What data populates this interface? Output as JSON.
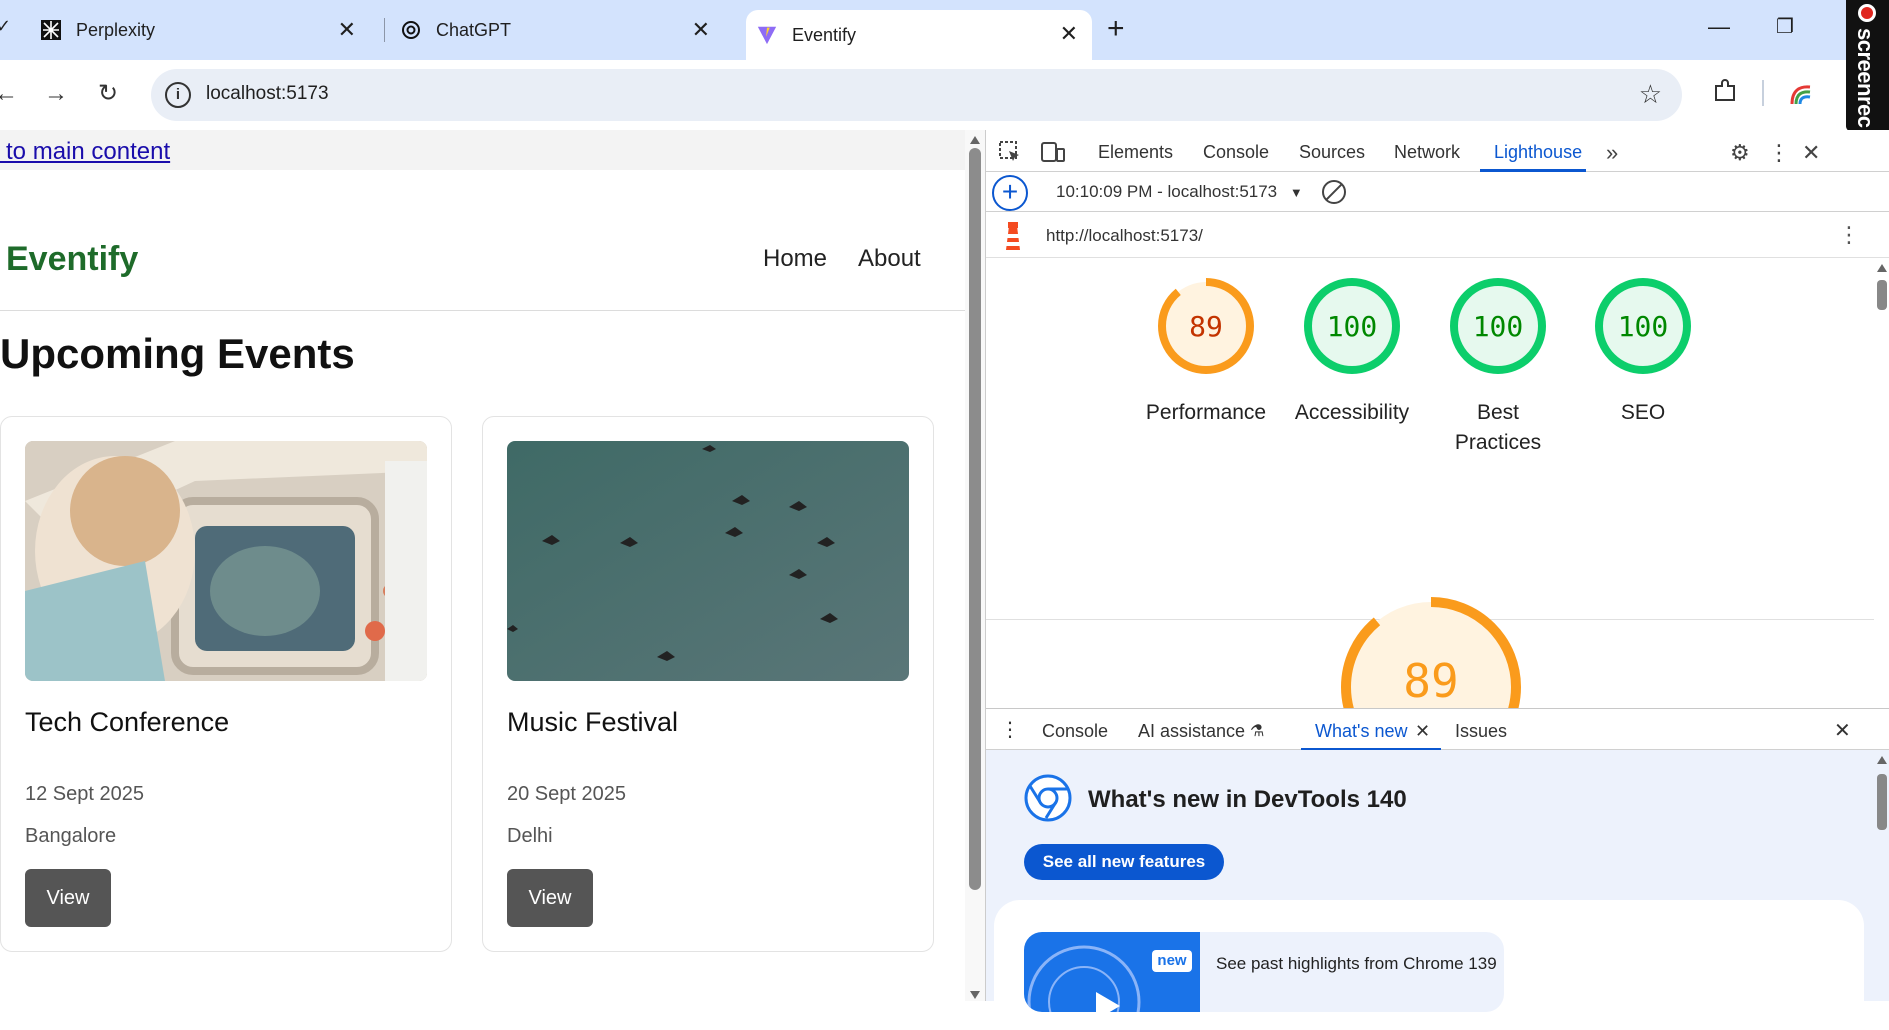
{
  "browser": {
    "tabs": [
      {
        "title": "Perplexity"
      },
      {
        "title": "ChatGPT"
      },
      {
        "title": "Eventify"
      }
    ],
    "address": "localhost:5173",
    "recorder_label": "screenrec"
  },
  "page": {
    "skip_link": "p to main content",
    "brand": "Eventify",
    "nav": [
      "Home",
      "About"
    ],
    "heading": "Upcoming Events",
    "events": [
      {
        "title": "Tech Conference",
        "date": "12 Sept 2025",
        "location": "Bangalore",
        "button": "View"
      },
      {
        "title": "Music Festival",
        "date": "20 Sept 2025",
        "location": "Delhi",
        "button": "View"
      }
    ]
  },
  "devtools": {
    "tabs": [
      "Elements",
      "Console",
      "Sources",
      "Network",
      "Lighthouse"
    ],
    "active_tab": "Lighthouse",
    "report_selector": "10:10:09 PM - localhost:5173",
    "report_url": "http://localhost:5173/",
    "scores": [
      {
        "label": "Performance",
        "value": 89,
        "color": "#fa9b1c",
        "text_color": "#c33300"
      },
      {
        "label": "Accessibility",
        "value": 100,
        "color": "#0cce6b",
        "text_color": "#008800"
      },
      {
        "label": "Best Practices",
        "value": 100,
        "color": "#0cce6b",
        "text_color": "#008800"
      },
      {
        "label": "SEO",
        "value": 100,
        "color": "#0cce6b",
        "text_color": "#008800"
      }
    ],
    "big_score": 89,
    "drawer": {
      "tabs": [
        "Console",
        "AI assistance",
        "What's new",
        "Issues"
      ],
      "active_tab": "What's new",
      "whats_new_title": "What's new in DevTools 140",
      "see_all": "See all new features",
      "new_badge": "new",
      "highlight_text": "See past highlights from Chrome 139"
    }
  }
}
